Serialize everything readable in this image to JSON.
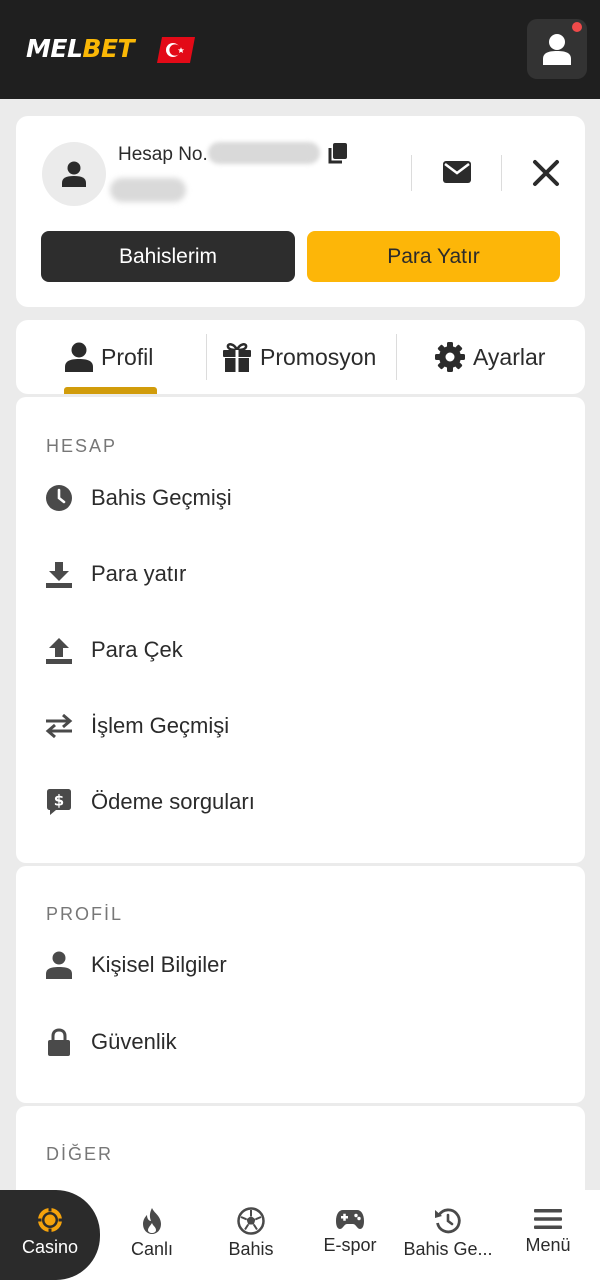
{
  "header": {
    "logo_part1": "MEL",
    "logo_part2": "BET",
    "flag": "turkey-flag",
    "user_icon": "user-icon",
    "has_notification": true,
    "accent_color": "#fbb806"
  },
  "account": {
    "label": "Hesap No.",
    "icons": [
      "user-icon",
      "copy-icon",
      "mail-icon",
      "close-icon"
    ],
    "buttons": {
      "bets": "Bahislerim",
      "deposit": "Para Yatır"
    }
  },
  "tabs": [
    {
      "label": "Profil",
      "icon": "user-icon",
      "active": true
    },
    {
      "label": "Promosyon",
      "icon": "gift-icon",
      "active": false
    },
    {
      "label": "Ayarlar",
      "icon": "gear-icon",
      "active": false
    }
  ],
  "sections": {
    "hesap": {
      "title": "HESAP",
      "items": [
        {
          "label": "Bahis Geçmişi",
          "icon": "clock-icon"
        },
        {
          "label": "Para yatır",
          "icon": "download-icon"
        },
        {
          "label": "Para Çek",
          "icon": "upload-icon"
        },
        {
          "label": "İşlem Geçmişi",
          "icon": "transfer-arrows-icon"
        },
        {
          "label": "Ödeme sorguları",
          "icon": "dollar-chat-icon"
        }
      ]
    },
    "profil": {
      "title": "PROFİL",
      "items": [
        {
          "label": "Kişisel Bilgiler",
          "icon": "person-icon"
        },
        {
          "label": "Güvenlik",
          "icon": "lock-icon"
        }
      ]
    },
    "diger": {
      "title": "DİĞER"
    }
  },
  "bottom_nav": [
    {
      "label": "Casino",
      "icon": "casino-chip-icon",
      "active": true
    },
    {
      "label": "Canlı",
      "icon": "flame-icon",
      "active": false
    },
    {
      "label": "Bahis",
      "icon": "soccer-ball-icon",
      "active": false
    },
    {
      "label": "E-spor",
      "icon": "gamepad-icon",
      "active": false
    },
    {
      "label": "Bahis Ge...",
      "icon": "history-icon",
      "active": false
    },
    {
      "label": "Menü",
      "icon": "menu-icon",
      "active": false
    }
  ]
}
